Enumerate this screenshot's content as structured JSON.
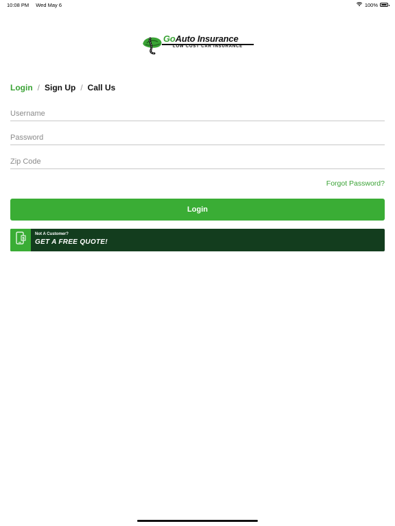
{
  "status_bar": {
    "time": "10:08 PM",
    "date": "Wed May 6",
    "battery": "100%"
  },
  "logo": {
    "title_go": "Go",
    "title_rest": "Auto Insurance",
    "tagline": "LOW COST CAR INSURANCE"
  },
  "tabs": {
    "items": [
      {
        "label": "Login",
        "active": true
      },
      {
        "label": "Sign Up",
        "active": false
      },
      {
        "label": "Call Us",
        "active": false
      }
    ],
    "separator": "/"
  },
  "form": {
    "username_placeholder": "Username",
    "password_placeholder": "Password",
    "zip_placeholder": "Zip Code",
    "forgot_label": "Forgot Password?",
    "login_label": "Login"
  },
  "quote_banner": {
    "small_text": "Not A Customer?",
    "big_text": "GET A FREE QUOTE!"
  },
  "colors": {
    "accent_green": "#3aad35",
    "banner_dark_green": "#133d1e"
  },
  "icons": [
    "wifi-icon",
    "battery-icon",
    "logo-emblem-icon",
    "phone-dollar-icon"
  ]
}
